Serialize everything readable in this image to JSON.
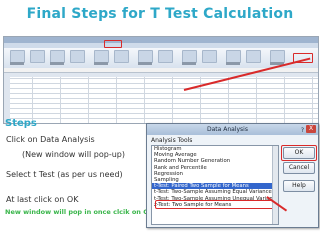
{
  "slide": {
    "title": "Final Steps for T Test Calculation",
    "heading": "Steps",
    "steps": [
      "Click on Data Analysis",
      "(New window will pop-up)",
      "Select t Test (as per us need)",
      "At last click on OK"
    ],
    "note": "New window will pop in once clcik on OK."
  },
  "dialog": {
    "title": "Data Analysis",
    "help_glyph": "?",
    "close_glyph": "X",
    "list_label": "Analysis Tools",
    "tools": [
      "Histogram",
      "Moving Average",
      "Random Number Generation",
      "Rank and Percentile",
      "Regression",
      "Sampling",
      "t-Test: Paired Two Sample for Means",
      "t-Test: Two-Sample Assuming Equal Variances",
      "t-Test: Two-Sample Assuming Unequal Variances",
      "z-Test: Two Sample for Means"
    ],
    "selected_index": 6,
    "ok_label": "OK",
    "cancel_label": "Cancel",
    "help_label": "Help"
  },
  "colors": {
    "title": "#2ea8c8",
    "note": "#39b54a",
    "highlight": "#d92a2a",
    "selection": "#3366cc"
  }
}
